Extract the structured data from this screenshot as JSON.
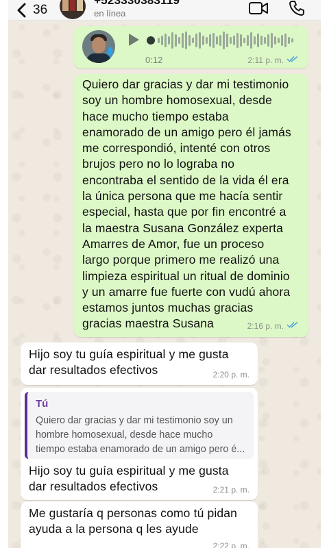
{
  "header": {
    "back_count": "36",
    "contact_name": "+523330383119",
    "contact_status": "en línea",
    "video_call_icon": "video-call-icon",
    "phone_icon": "phone-icon"
  },
  "voice_note": {
    "duration": "0:12",
    "time": "2:11 p. m.",
    "status": "read"
  },
  "messages": [
    {
      "direction": "outgoing",
      "lines": [
        "Quiero dar gracias y dar mi testimonio",
        "soy un hombre homosexual, desde",
        "hace mucho tiempo estaba",
        "enamorado de un amigo pero él jamás",
        "me correspondió, intenté con otros",
        "brujos pero no lo lograba no",
        "encontraba el sentido de la vida él era",
        "la única persona que me hacía sentir",
        "especial, hasta que por fin encontré a",
        "la maestra Susana González experta",
        "Amarres de Amor, fue un proceso",
        "largo porque primero me realizó una",
        "limpieza espiritual un ritual de dominio",
        "y un amarre fue fuerte con vudú ahora",
        "estamos juntos muchas gracias",
        "gracias maestra Susana"
      ],
      "time": "2:16 p. m.",
      "status": "read"
    },
    {
      "direction": "incoming",
      "lines": [
        "Hijo soy tu guía espiritual y me gusta",
        "dar resultados efectivos"
      ],
      "time": "2:20 p. m."
    },
    {
      "direction": "incoming",
      "reply_to": {
        "author": "Tú",
        "lines": [
          "Quiero dar gracias y dar mi testimonio soy un",
          "hombre homosexual, desde hace mucho",
          "tiempo estaba enamorado de un amigo pero é..."
        ]
      },
      "lines": [
        "Hijo soy tu guía espiritual y me gusta",
        "dar resultados efectivos"
      ],
      "time": "2:21 p. m."
    },
    {
      "direction": "incoming",
      "lines": [
        "Me gustaría q personas como tú pidan",
        "ayuda a la persona q les ayude"
      ],
      "time": "2:22 p. m."
    }
  ],
  "colors": {
    "outgoing_bubble": "#dcf8c6",
    "incoming_bubble": "#ffffff",
    "read_ticks": "#4fa3e0",
    "reply_bar": "#5b2f91"
  }
}
